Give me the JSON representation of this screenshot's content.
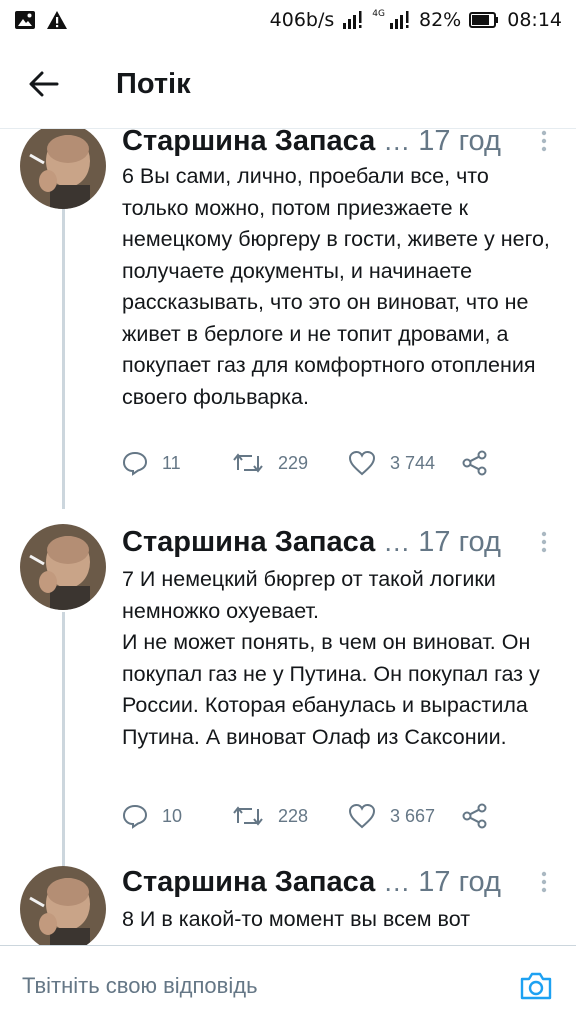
{
  "status_bar": {
    "net_speed": "406b/s",
    "network": "4G",
    "battery": "82%",
    "time": "08:14"
  },
  "header": {
    "title": "Потік"
  },
  "tweets": [
    {
      "author": "Старшина Запаса",
      "dots": "…",
      "time": "17 год",
      "lines": [
        "6 Вы сами, лично, проебали все, что только можно, потом приезжаете к немецкому бюргеру в гости, живете у него, получаете документы, и начинаете рассказывать, что это он виноват, что не живет в берлоге и не топит дровами, а покупает газ для комфортного отопления своего фольварка."
      ],
      "replies": "11",
      "retweets": "229",
      "likes": "3 744"
    },
    {
      "author": "Старшина Запаса",
      "dots": "…",
      "time": "17 год",
      "lines": [
        "7 И немецкий бюргер от такой логики немножко охуевает.",
        "И не может понять, в чем он виноват. Он покупал газ не у Путина. Он покупал газ у России. Которая ебанулась и вырастила Путина. А виноват Олаф из Саксонии."
      ],
      "replies": "10",
      "retweets": "228",
      "likes": "3 667"
    },
    {
      "author": "Старшина Запаса",
      "dots": "…",
      "time": "17 год",
      "lines": [
        "8 И в какой-то момент вы всем вот"
      ]
    }
  ],
  "reply_bar": {
    "placeholder": "Твітніть свою відповідь"
  },
  "colors": {
    "accent": "#1da1f2",
    "text": "#14171a",
    "secondary": "#657786",
    "thread_line": "#ccd6dd"
  }
}
